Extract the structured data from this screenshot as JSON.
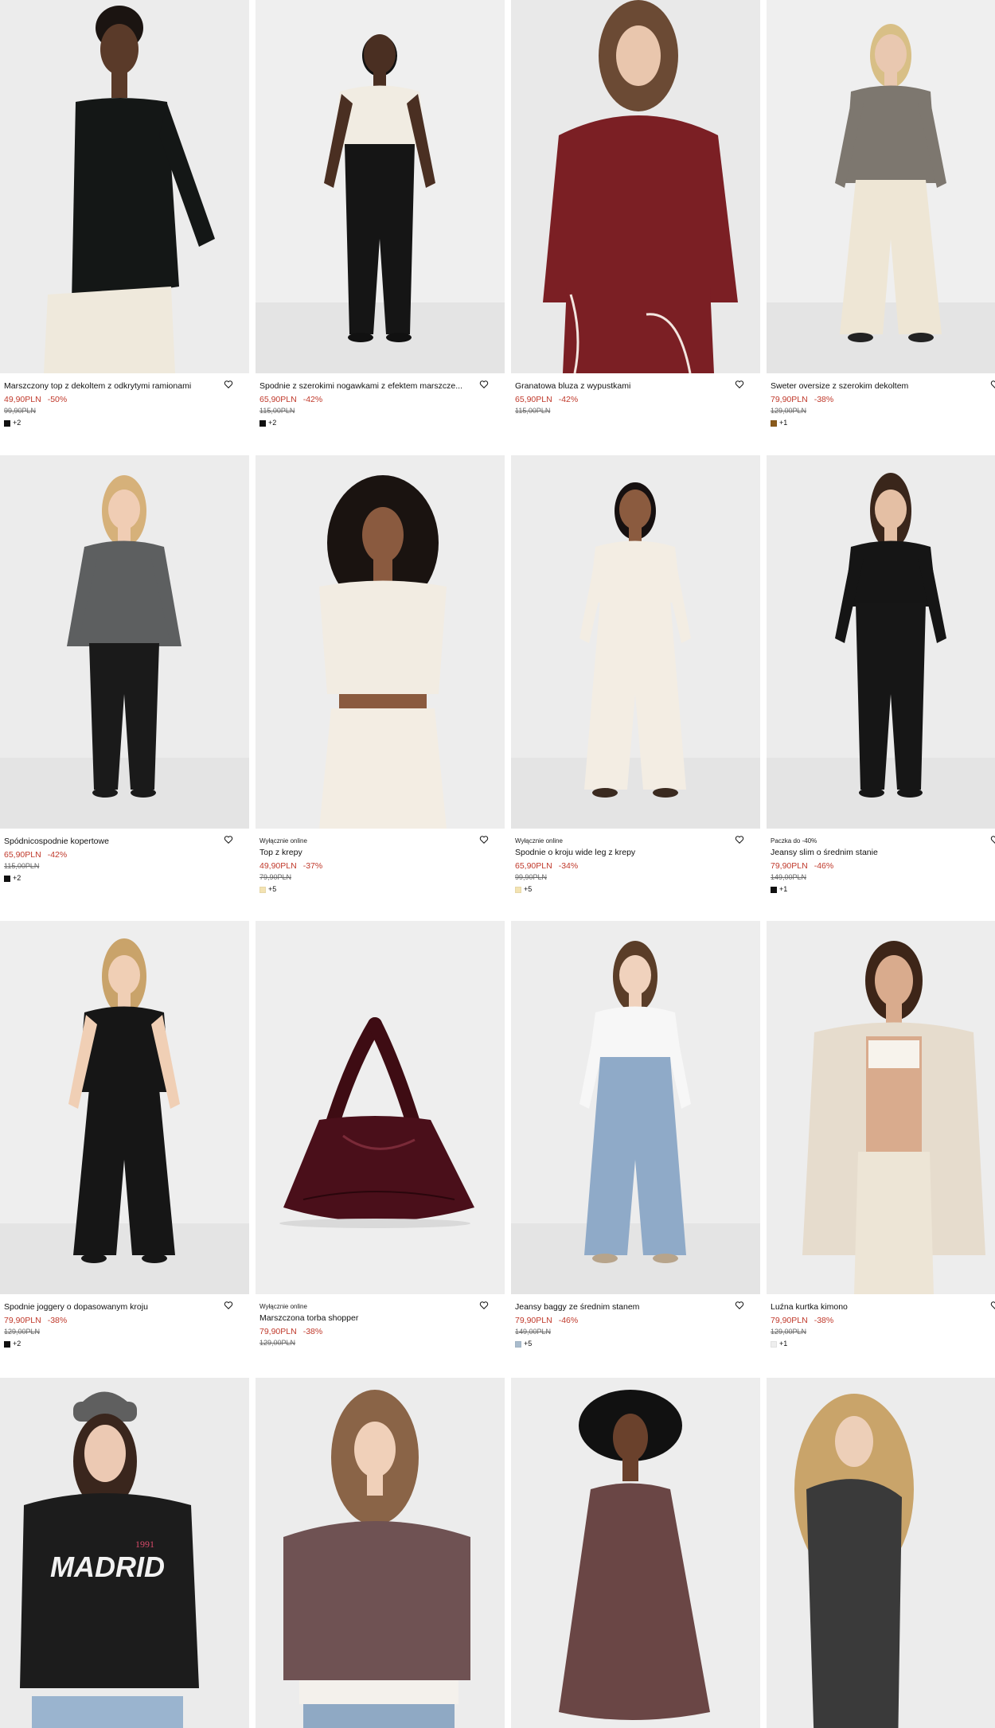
{
  "products": [
    {
      "badge": "",
      "name": "Marszczony top z dekoltem z odkrytymi ramionami",
      "price": "49,90PLN",
      "discount": "-50%",
      "old_price": "99,90PLN",
      "swatch": "#111111",
      "more_colors": "+2"
    },
    {
      "badge": "",
      "name": "Spodnie z szerokimi nogawkami z efektem marszcze...",
      "price": "65,90PLN",
      "discount": "-42%",
      "old_price": "115,00PLN",
      "swatch": "#111111",
      "more_colors": "+2"
    },
    {
      "badge": "",
      "name": "Granatowa bluza z wypustkami",
      "price": "65,90PLN",
      "discount": "-42%",
      "old_price": "115,00PLN",
      "swatch": "",
      "more_colors": ""
    },
    {
      "badge": "",
      "name": "Sweter oversize z szerokim dekoltem",
      "price": "79,90PLN",
      "discount": "-38%",
      "old_price": "129,00PLN",
      "swatch": "#8a5a1c",
      "more_colors": "+1"
    },
    {
      "badge": "",
      "name": "Spódnicospodnie kopertowe",
      "price": "65,90PLN",
      "discount": "-42%",
      "old_price": "115,00PLN",
      "swatch": "#111111",
      "more_colors": "+2"
    },
    {
      "badge": "Wyłącznie online",
      "name": "Top z krepy",
      "price": "49,90PLN",
      "discount": "-37%",
      "old_price": "79,90PLN",
      "swatch": "#f3e3b2",
      "more_colors": "+5"
    },
    {
      "badge": "Wyłącznie online",
      "name": "Spodnie o kroju wide leg z krepy",
      "price": "65,90PLN",
      "discount": "-34%",
      "old_price": "99,90PLN",
      "swatch": "#f3e3b2",
      "more_colors": "+5"
    },
    {
      "badge": "Paczka do -40%",
      "name": "Jeansy slim o średnim stanie",
      "price": "79,90PLN",
      "discount": "-46%",
      "old_price": "149,00PLN",
      "swatch": "#111111",
      "more_colors": "+1"
    },
    {
      "badge": "",
      "name": "Spodnie joggery o dopasowanym kroju",
      "price": "79,90PLN",
      "discount": "-38%",
      "old_price": "129,00PLN",
      "swatch": "#111111",
      "more_colors": "+2"
    },
    {
      "badge": "Wyłącznie online",
      "name": "Marszczona torba shopper",
      "price": "79,90PLN",
      "discount": "-38%",
      "old_price": "129,00PLN",
      "swatch": "",
      "more_colors": ""
    },
    {
      "badge": "",
      "name": "Jeansy baggy ze średnim stanem",
      "price": "79,90PLN",
      "discount": "-46%",
      "old_price": "149,00PLN",
      "swatch": "#a9bccd",
      "more_colors": "+5"
    },
    {
      "badge": "",
      "name": "Luźna kurtka kimono",
      "price": "79,90PLN",
      "discount": "-38%",
      "old_price": "129,00PLN",
      "swatch": "#eeeeee",
      "more_colors": "+1"
    },
    {
      "badge": "",
      "name": "",
      "price": "",
      "discount": "",
      "old_price": "",
      "swatch": "",
      "more_colors": ""
    },
    {
      "badge": "",
      "name": "",
      "price": "",
      "discount": "",
      "old_price": "",
      "swatch": "",
      "more_colors": ""
    },
    {
      "badge": "",
      "name": "",
      "price": "",
      "discount": "",
      "old_price": "",
      "swatch": "",
      "more_colors": ""
    },
    {
      "badge": "",
      "name": "",
      "price": "",
      "discount": "",
      "old_price": "",
      "swatch": "",
      "more_colors": ""
    }
  ],
  "print_text": {
    "madrid": "MADRID",
    "year": "1991"
  },
  "colors": {
    "price_red": "#c0392b",
    "background": "#ffffff",
    "photo_bg": "#ececec"
  },
  "icons": {
    "favorite": "heart-outline-icon"
  }
}
